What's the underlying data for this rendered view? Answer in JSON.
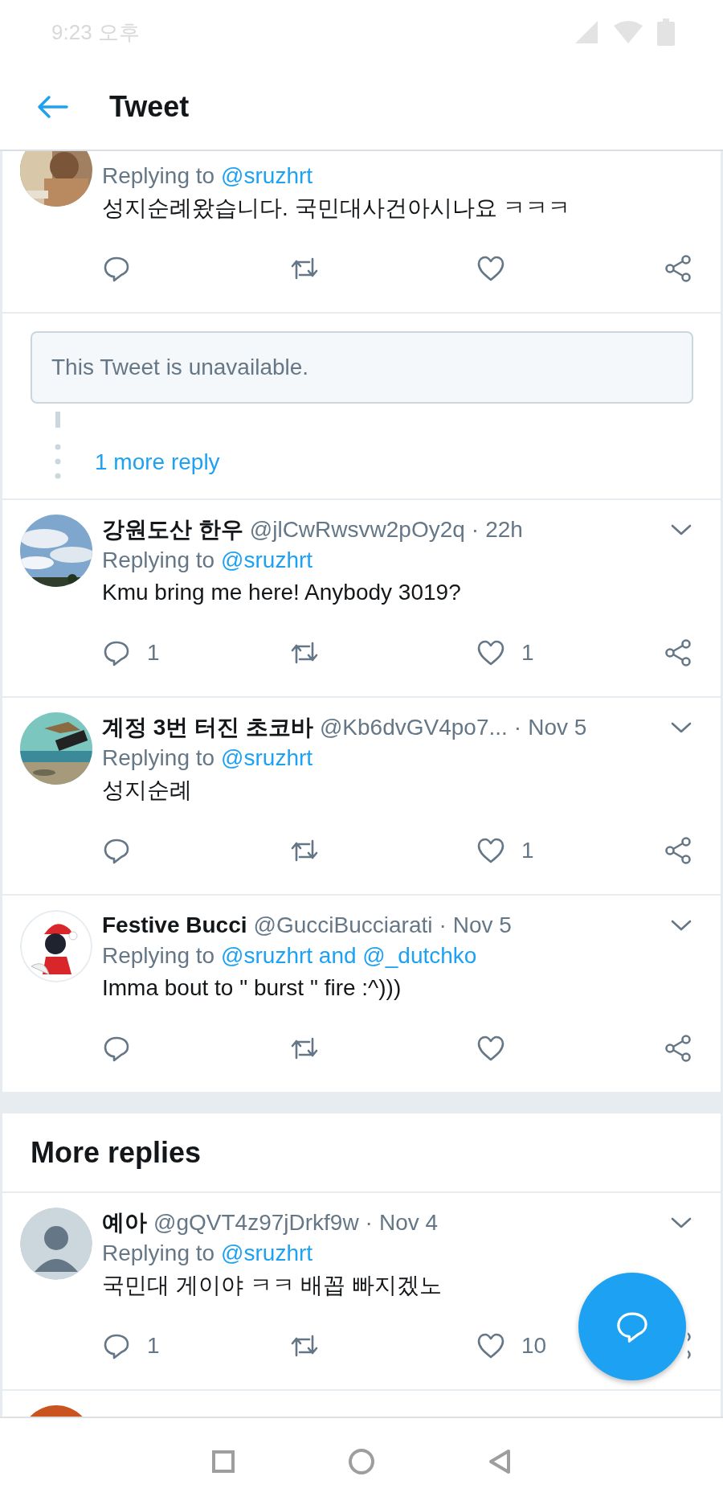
{
  "status_bar": {
    "time": "9:23 오후"
  },
  "header": {
    "title": "Tweet"
  },
  "timeline": [
    {
      "kind": "tweet",
      "cut_top": true,
      "replying_label": "Replying to",
      "replying_to": "@sruzhrt",
      "text": "성지순례왔습니다. 국민대사건아시나요 ㅋㅋㅋ"
    },
    {
      "kind": "unavailable",
      "notice": "This Tweet is unavailable.",
      "more_link": "1 more reply"
    },
    {
      "kind": "tweet",
      "name": "강원도산 한우",
      "handle": "@jlCwRwsvw2pOy2q",
      "separator": "·",
      "time": "22h",
      "replying_label": "Replying to",
      "replying_to": "@sruzhrt",
      "text": "Kmu bring me here! Anybody 3019?",
      "reply_count": "1",
      "like_count": "1"
    },
    {
      "kind": "tweet",
      "name": "계정 3번 터진 초코바",
      "handle": "@Kb6dvGV4po7...",
      "separator": "·",
      "time": "Nov 5",
      "replying_label": "Replying to",
      "replying_to": "@sruzhrt",
      "text": "성지순례",
      "like_count": "1"
    },
    {
      "kind": "tweet",
      "name": "Festive Bucci",
      "handle": "@GucciBucciarati",
      "separator": "·",
      "time": "Nov 5",
      "replying_label": "Replying to",
      "replying_to": "@sruzhrt and @_dutchko",
      "text": "Imma bout to \" burst \" fire :^)))"
    },
    {
      "kind": "section",
      "title": "More replies"
    },
    {
      "kind": "tweet",
      "avatar": {
        "kind": "default"
      },
      "name": "예아",
      "handle": "@gQVT4z97jDrkf9w",
      "separator": "·",
      "time": "Nov 4",
      "replying_label": "Replying to",
      "replying_to": "@sruzhrt",
      "text": "국민대 게이야 ㅋㅋ 배꼽 빠지겠노",
      "reply_count": "1",
      "like_count": "10"
    },
    {
      "kind": "partial"
    }
  ]
}
